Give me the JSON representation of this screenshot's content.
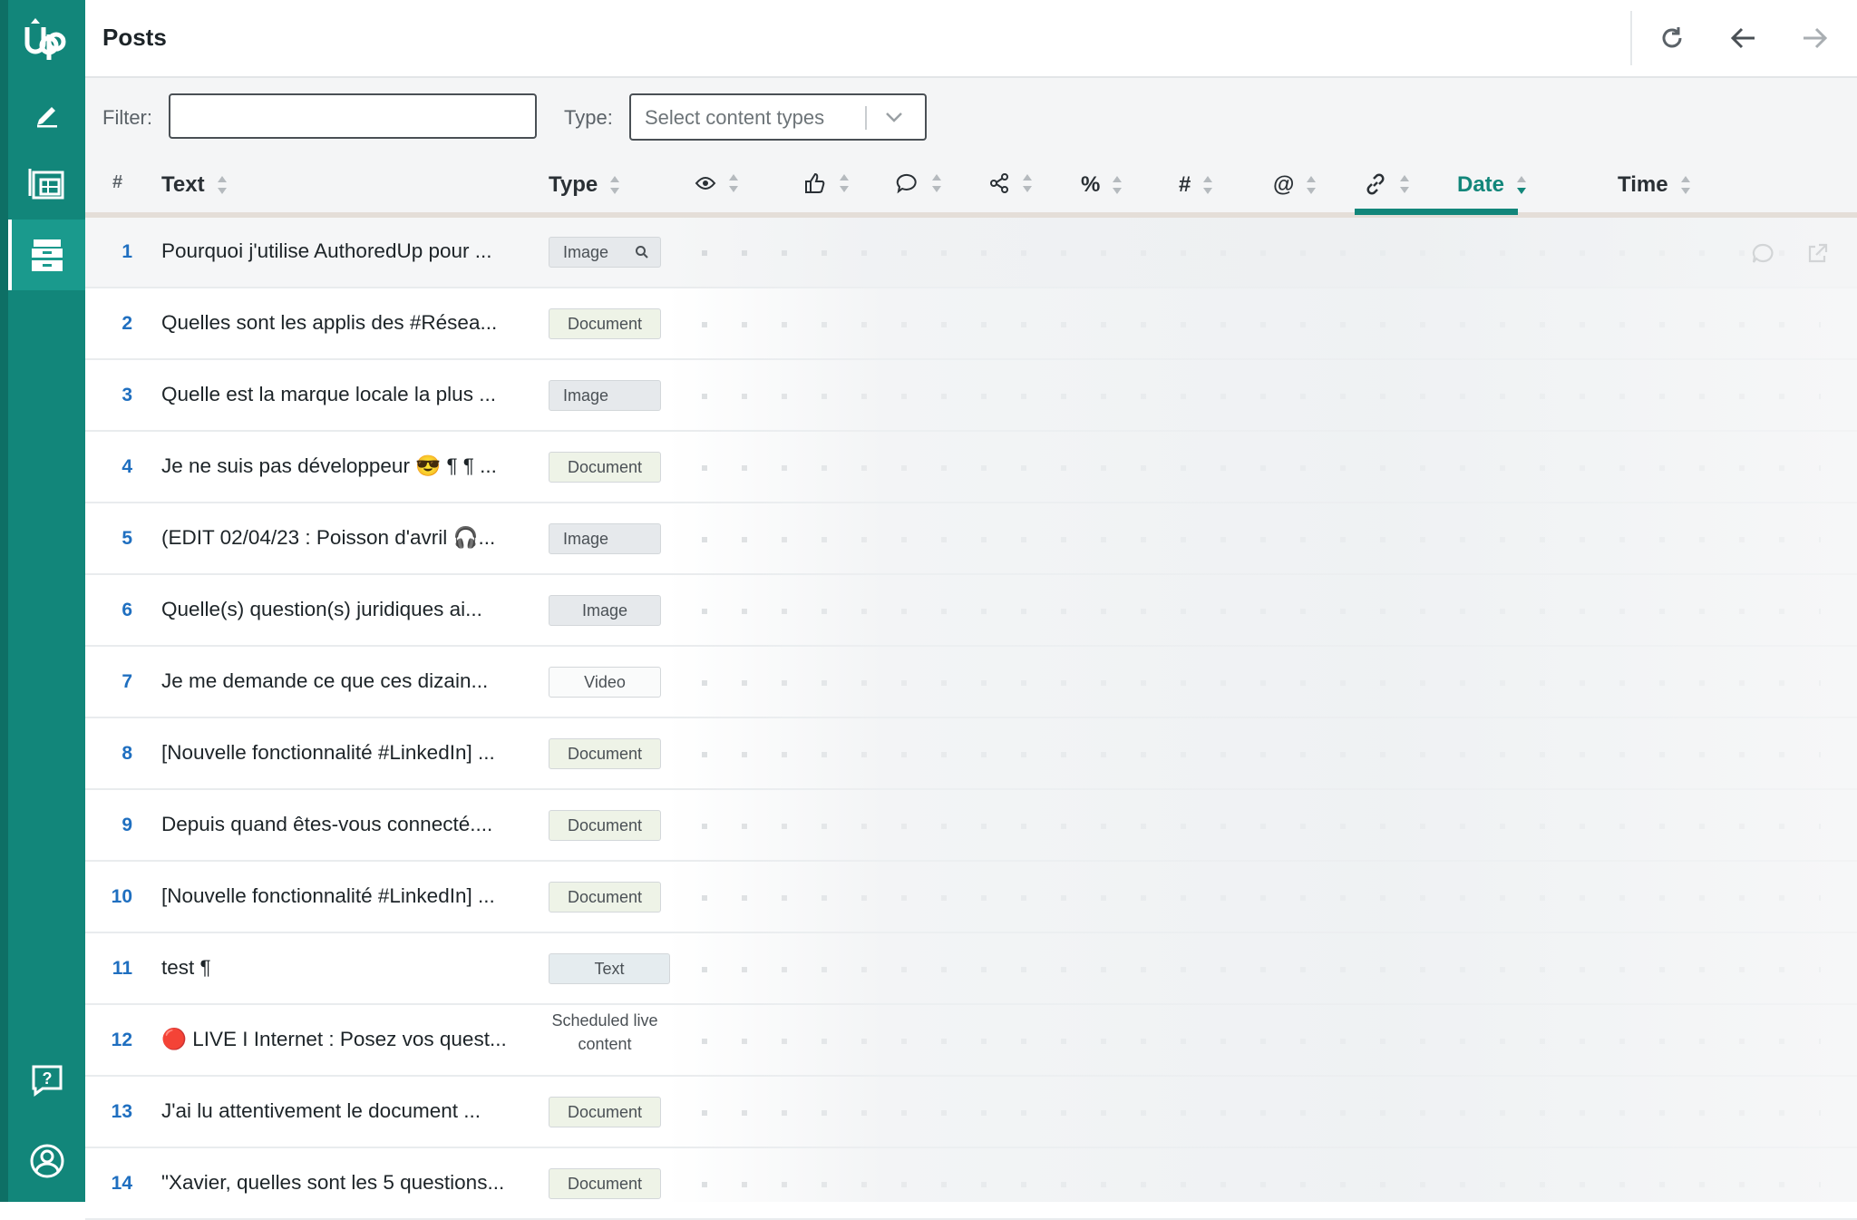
{
  "app": {
    "logo_text": "Up",
    "page_title": "Posts"
  },
  "filters": {
    "filter_label": "Filter:",
    "filter_value": "",
    "type_label": "Type:",
    "type_placeholder": "Select content types"
  },
  "columns": {
    "num": "#",
    "text": "Text",
    "type": "Type",
    "date": "Date",
    "time": "Time",
    "icon_columns": [
      "views-icon",
      "likes-icon",
      "comments-icon",
      "shares-icon",
      "engagement-rate-icon",
      "hashtags-icon",
      "mentions-icon",
      "links-icon"
    ],
    "sorted_column": "date",
    "accent_color": "#12867a"
  },
  "rows": [
    {
      "num": "1",
      "text": "Pourquoi j'utilise AuthoredUp pour ...",
      "type": "Image",
      "kind": "image"
    },
    {
      "num": "2",
      "text": "Quelles sont les applis des #Résea...",
      "type": "Document",
      "kind": "document"
    },
    {
      "num": "3",
      "text": "Quelle est la marque locale la plus ...",
      "type": "Image",
      "kind": "image"
    },
    {
      "num": "4",
      "text": "Je ne suis pas développeur 😎 ¶ ¶ ...",
      "type": "Document",
      "kind": "document"
    },
    {
      "num": "5",
      "text": "(EDIT 02/04/23 : Poisson d'avril 🎧...",
      "type": "Image",
      "kind": "image"
    },
    {
      "num": "6",
      "text": "Quelle(s) question(s) juridiques ai...",
      "type": "Image",
      "kind": "image"
    },
    {
      "num": "7",
      "text": "Je me demande ce que ces dizain...",
      "type": "Video",
      "kind": "video"
    },
    {
      "num": "8",
      "text": "[Nouvelle fonctionnalité #LinkedIn] ...",
      "type": "Document",
      "kind": "document"
    },
    {
      "num": "9",
      "text": "Depuis quand êtes-vous connecté....",
      "type": "Document",
      "kind": "document"
    },
    {
      "num": "10",
      "text": "[Nouvelle fonctionnalité #LinkedIn] ...",
      "type": "Document",
      "kind": "document"
    },
    {
      "num": "11",
      "text": "test ¶",
      "type": "Text",
      "kind": "text"
    },
    {
      "num": "12",
      "text": "🔴 LIVE I Internet : Posez vos quest...",
      "type": "Scheduled live content",
      "kind": "sched"
    },
    {
      "num": "13",
      "text": "J'ai lu attentivement le document ...",
      "type": "Document",
      "kind": "document"
    },
    {
      "num": "14",
      "text": "\"Xavier, quelles sont les 5 questions...",
      "type": "Document",
      "kind": "document"
    }
  ]
}
